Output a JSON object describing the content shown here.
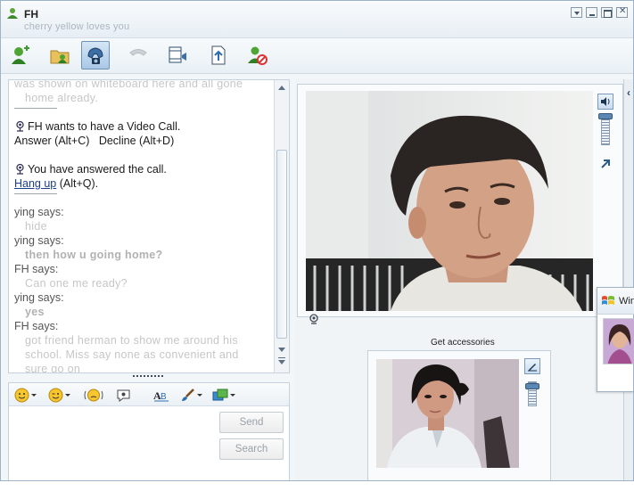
{
  "window": {
    "title": "FH",
    "subtitle": "cherry yellow loves you"
  },
  "toolbar": {
    "items": [
      {
        "name": "add-contact",
        "state": "normal"
      },
      {
        "name": "share-folders",
        "state": "normal"
      },
      {
        "name": "video-call",
        "state": "active"
      },
      {
        "name": "call-phone",
        "state": "disabled"
      },
      {
        "name": "share-video",
        "state": "normal"
      },
      {
        "name": "send-file",
        "state": "normal"
      },
      {
        "name": "block-contact",
        "state": "normal"
      }
    ]
  },
  "chat": {
    "top_fragment_1": "was shown on whiteboard here and all gone",
    "top_fragment_2": "home already.",
    "video_request": "FH wants to have a Video Call.",
    "answer_label": "Answer (Alt+C)",
    "decline_label": "Decline (Alt+D)",
    "answered": "You have answered the call.",
    "hangup_link": "Hang up",
    "hangup_shortcut": "(Alt+Q).",
    "messages": [
      {
        "speaker": "ying says:",
        "text": "hide"
      },
      {
        "speaker": "ying says:",
        "text": "then how u going home?"
      },
      {
        "speaker": "FH says:",
        "text": "Can one me ready?"
      },
      {
        "speaker": "ying says:",
        "text": "yes"
      },
      {
        "speaker": "FH says:",
        "text": "got friend herman to show me around his"
      },
      {
        "speaker": "",
        "text": "school. Miss say none as convenient and"
      },
      {
        "speaker": "",
        "text": "sure go on"
      }
    ]
  },
  "compose": {
    "send_label": "Send",
    "search_label": "Search"
  },
  "video": {
    "accessories_label": "Get accessories"
  },
  "popup": {
    "label": "Windows"
  }
}
